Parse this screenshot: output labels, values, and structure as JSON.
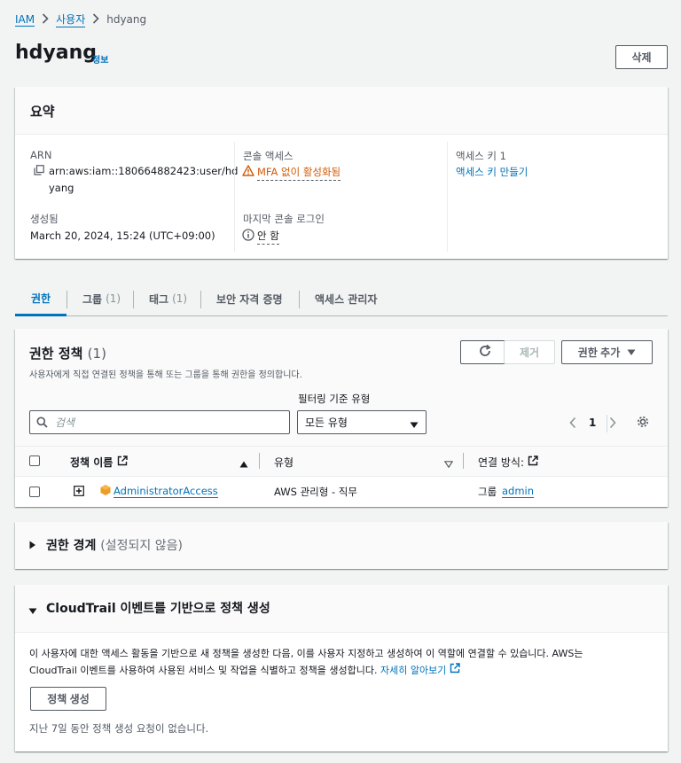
{
  "breadcrumb": {
    "root": "IAM",
    "users": "사용자",
    "current": "hdyang"
  },
  "header": {
    "title": "hdyang",
    "info": "정보",
    "delete_label": "삭제"
  },
  "summary": {
    "title": "요약",
    "arn_label": "ARN",
    "arn_line1": "arn:aws:iam::180664882423:user/hd",
    "arn_line2": "yang",
    "created_label": "생성됨",
    "created_value": "March 20, 2024, 15:24 (UTC+09:00)",
    "console_access_label": "콘솔 액세스",
    "console_access_value": "MFA 없이 활성화됨",
    "last_login_label": "마지막 콘솔 로그인",
    "last_login_value": "안 함",
    "access_key_label": "액세스 키 1",
    "access_key_link": "액세스 키 만들기"
  },
  "tabs": [
    {
      "label": "권한",
      "count": ""
    },
    {
      "label": "그룹",
      "count": "(1)"
    },
    {
      "label": "태그",
      "count": "(1)"
    },
    {
      "label": "보안 자격 증명",
      "count": ""
    },
    {
      "label": "액세스 관리자",
      "count": ""
    }
  ],
  "policies": {
    "title": "권한 정책",
    "count": "(1)",
    "description": "사용자에게 직접 연결된 정책을 통해 또는 그룹을 통해 권한을 정의합니다.",
    "remove_label": "제거",
    "add_label": "권한 추가",
    "filter_label": "필터링 기준 유형",
    "search_placeholder": "검색",
    "select_value": "모든 유형",
    "page": "1",
    "columns": {
      "name": "정책 이름",
      "type": "유형",
      "attached": "연결 방식:"
    },
    "rows": [
      {
        "name": "AdministratorAccess",
        "type": "AWS 관리형 - 직무",
        "attached_prefix": "그룹",
        "attached_link": "admin"
      }
    ]
  },
  "boundary": {
    "title": "권한 경계",
    "status": "(설정되지 않음)"
  },
  "cloudtrail": {
    "title": "CloudTrail 이벤트를 기반으로 정책 생성",
    "body_line1": "이 사용자에 대한 액세스 활동을 기반으로 새 정책을 생성한 다음, 이를 사용자 지정하고 생성하여 이 역할에 연결할 수 있습니다. AWS는",
    "body_line2": "CloudTrail 이벤트를 사용하여 사용된 서비스 및 작업을 식별하고 정책을 생성합니다.",
    "learn_more": "자세히 알아보기",
    "button_label": "정책 생성",
    "footer": "지난 7일 동안 정책 생성 요청이 없습니다."
  },
  "colors": {
    "link": "#0073bb",
    "warning": "#d45b07",
    "text": "#16191f",
    "background": "#f2f3f3"
  }
}
